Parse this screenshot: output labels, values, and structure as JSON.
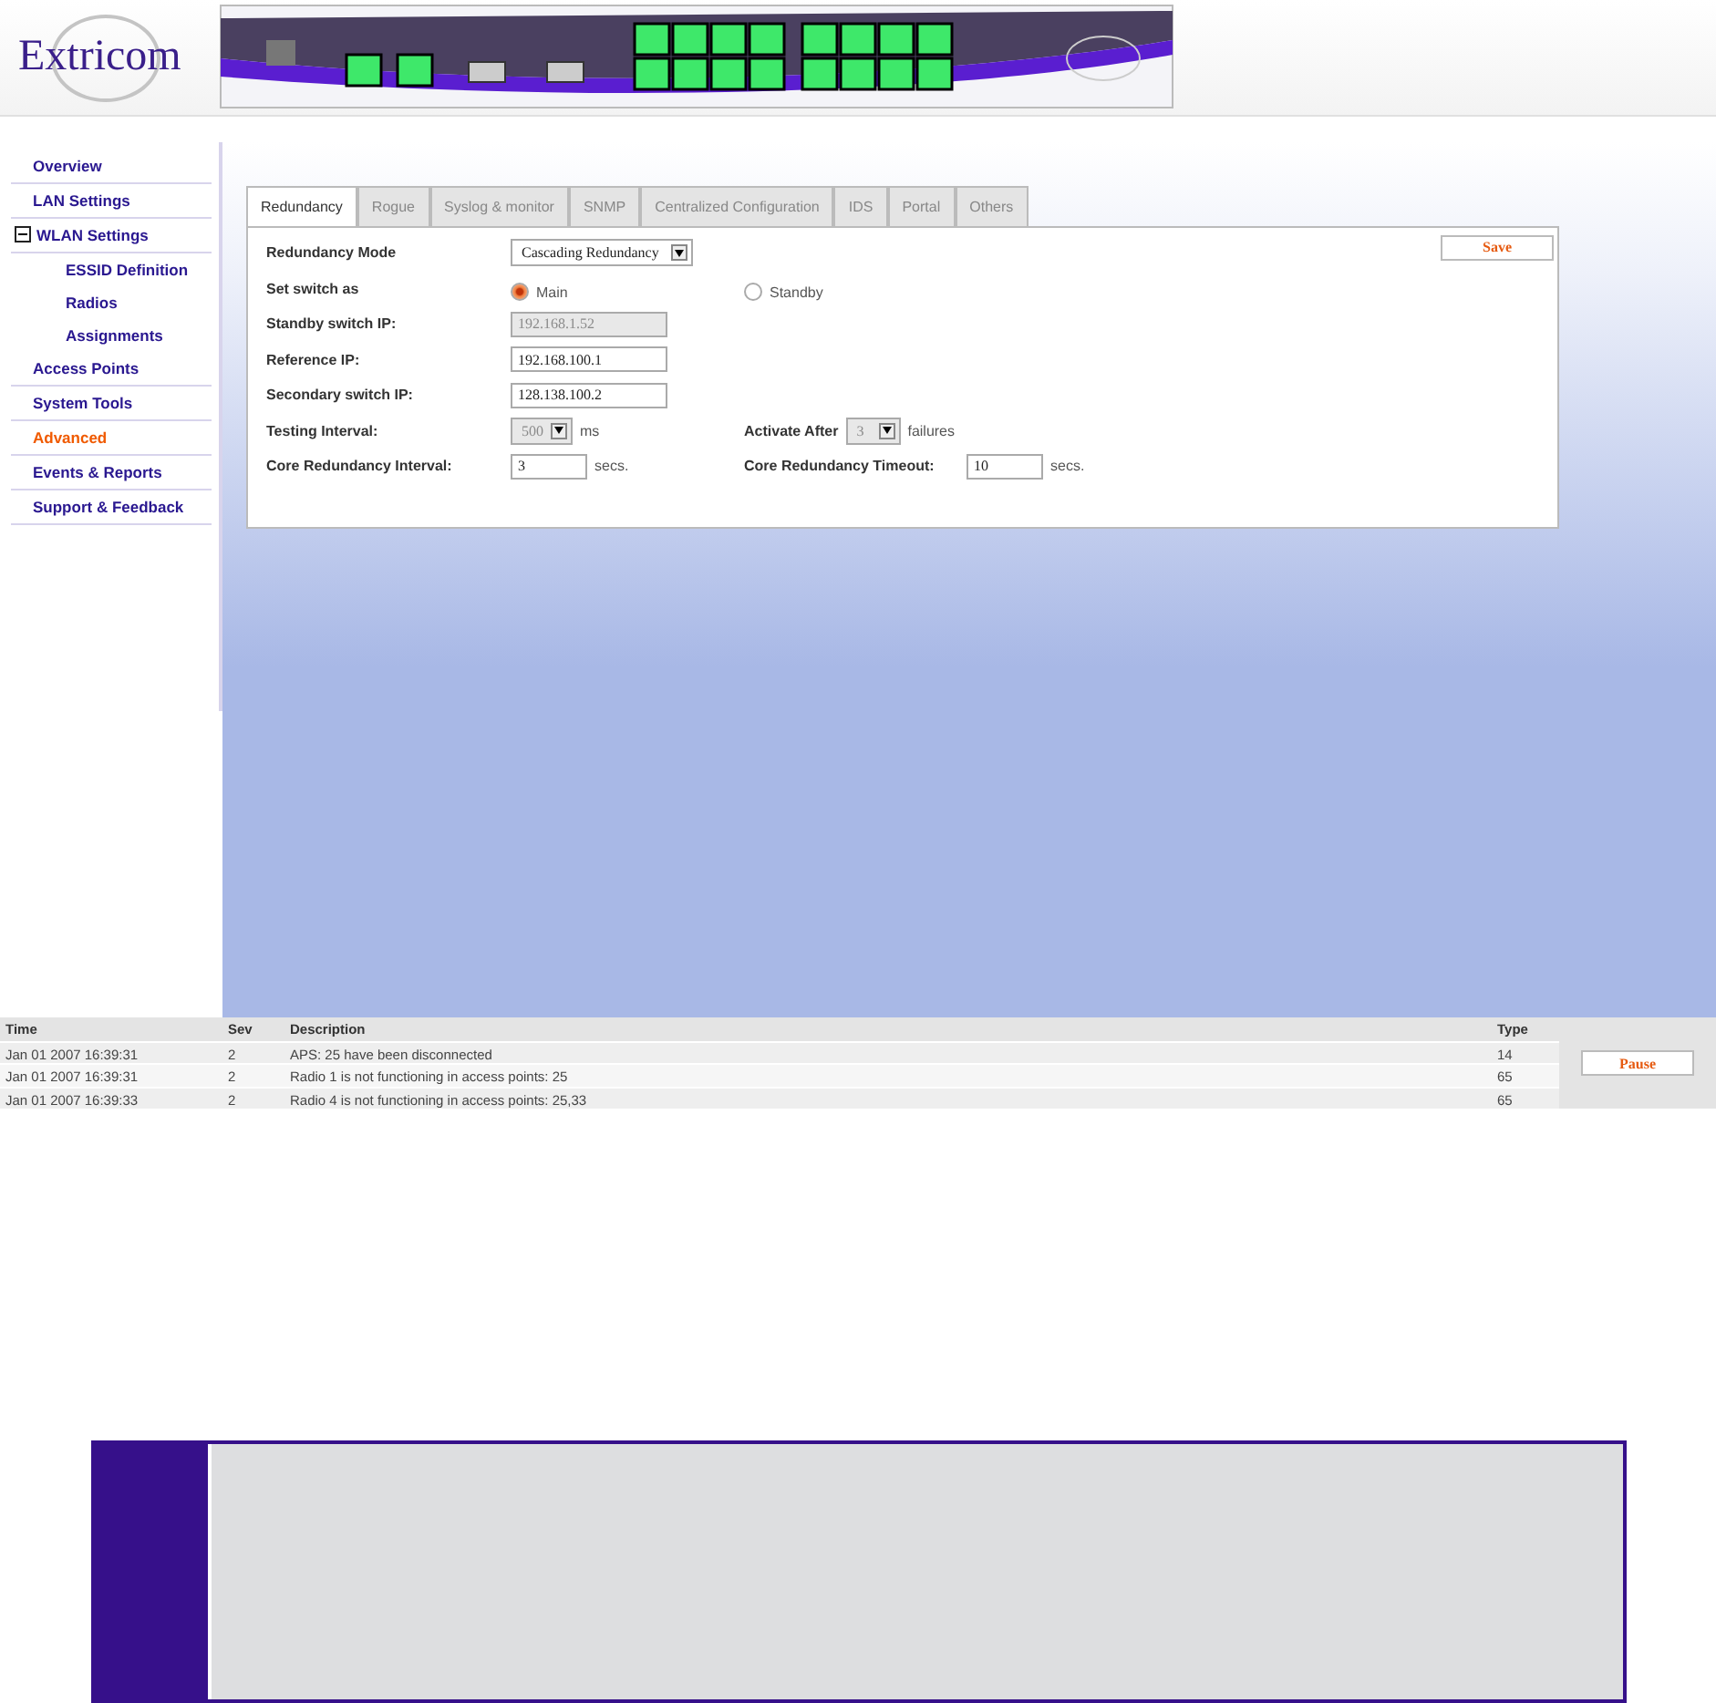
{
  "logo": {
    "text": "Extricom"
  },
  "sidebar": {
    "items": [
      {
        "label": "Overview",
        "selected": false
      },
      {
        "label": "LAN Settings",
        "selected": false
      },
      {
        "label": "WLAN Settings",
        "selected": false,
        "expanded": true,
        "children": [
          {
            "label": "ESSID Definition",
            "selected": false
          },
          {
            "label": "Radios",
            "selected": false
          },
          {
            "label": "Assignments",
            "selected": false
          }
        ]
      },
      {
        "label": "Access Points",
        "selected": false
      },
      {
        "label": "System Tools",
        "selected": false
      },
      {
        "label": "Advanced",
        "selected": true
      },
      {
        "label": "Events & Reports",
        "selected": false
      },
      {
        "label": "Support & Feedback",
        "selected": false
      }
    ]
  },
  "tabs": [
    {
      "label": "Redundancy",
      "selected": true
    },
    {
      "label": "Rogue",
      "selected": false
    },
    {
      "label": "Syslog & monitor",
      "selected": false
    },
    {
      "label": "SNMP",
      "selected": false
    },
    {
      "label": "Centralized Configuration",
      "selected": false
    },
    {
      "label": "IDS",
      "selected": false
    },
    {
      "label": "Portal",
      "selected": false
    },
    {
      "label": "Others",
      "selected": false
    }
  ],
  "save_button": "Save",
  "form": [
    {
      "kind": "select",
      "label": "Redundancy Mode",
      "value": "Cascading Redundancy",
      "disabled": false
    },
    {
      "kind": "radio",
      "label": "Set switch as",
      "options": [
        {
          "label": "Main",
          "selected": true
        },
        {
          "label": "Standby",
          "selected": false
        }
      ]
    },
    {
      "kind": "text",
      "label": "Standby switch IP:",
      "value": "192.168.1.52",
      "disabled": true
    },
    {
      "kind": "text",
      "label": "Reference IP:",
      "value": "192.168.100.1",
      "disabled": false
    },
    {
      "kind": "text",
      "label": "Secondary switch IP:",
      "value": "128.138.100.2",
      "disabled": false
    },
    {
      "kind": "pair",
      "left": {
        "kind": "select",
        "label": "Testing Interval:",
        "value": "500",
        "unit": "ms",
        "disabled": true
      },
      "right": {
        "kind": "select",
        "label": "Activate After",
        "value": "3",
        "unit": "failures",
        "disabled": true
      }
    },
    {
      "kind": "pair",
      "left": {
        "kind": "short",
        "label": "Core Redundancy Interval:",
        "value": "3",
        "unit": "secs.",
        "disabled": false
      },
      "right": {
        "kind": "short",
        "label": "Core Redundancy Timeout:",
        "value": "10",
        "unit": "secs.",
        "disabled": false
      }
    }
  ],
  "log": {
    "columns": [
      "Time",
      "Sev",
      "Description",
      "Type"
    ],
    "rows": [
      [
        "Jan 01 2007 16:39:31",
        "2",
        "APS: 25 have been disconnected",
        "14"
      ],
      [
        "Jan 01 2007 16:39:31",
        "2",
        "Radio 1 is not functioning in access points: 25",
        "65"
      ],
      [
        "Jan 01 2007 16:39:33",
        "2",
        "Radio 4 is not functioning in access points: 25,33",
        "65"
      ]
    ],
    "pause_button": "Pause"
  }
}
